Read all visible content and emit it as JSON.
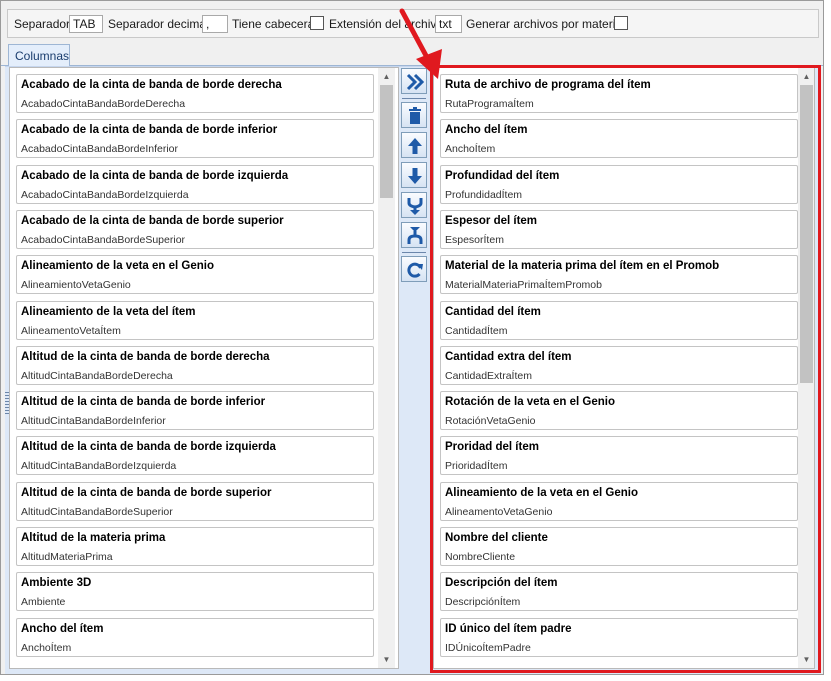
{
  "toolbar": {
    "separator_label": "Separador",
    "separator_value": "TAB",
    "decimal_label": "Separador decimal",
    "decimal_value": ",",
    "header_label": "Tiene cabecera",
    "extension_label": "Extensión del archivo",
    "extension_value": "txt",
    "per_material_label": "Generar archivos por material"
  },
  "tab": {
    "label": "Columnas"
  },
  "available": [
    {
      "title": "Acabado de la cinta de banda de borde derecha",
      "key": "AcabadoCintaBandaBordeDerecha"
    },
    {
      "title": "Acabado de la cinta de banda de borde inferior",
      "key": "AcabadoCintaBandaBordeInferior"
    },
    {
      "title": "Acabado de la cinta de banda de borde izquierda",
      "key": "AcabadoCintaBandaBordeIzquierda"
    },
    {
      "title": "Acabado de la cinta de banda de borde superior",
      "key": "AcabadoCintaBandaBordeSuperior"
    },
    {
      "title": "Alineamiento de la veta en el Genio",
      "key": "AlineamientoVetaGenio"
    },
    {
      "title": "Alineamiento de la veta del ítem",
      "key": "AlineamentoVetaÍtem"
    },
    {
      "title": "Altitud de la cinta de banda de borde derecha",
      "key": "AltitudCintaBandaBordeDerecha"
    },
    {
      "title": "Altitud de la cinta de banda de borde inferior",
      "key": "AltitudCintaBandaBordeInferior"
    },
    {
      "title": "Altitud de la cinta de banda de borde izquierda",
      "key": "AltitudCintaBandaBordeIzquierda"
    },
    {
      "title": "Altitud de la cinta de banda de borde superior",
      "key": "AltitudCintaBandaBordeSuperior"
    },
    {
      "title": "Altitud de la materia prima",
      "key": "AltitudMateriaPrima"
    },
    {
      "title": "Ambiente 3D",
      "key": "Ambiente"
    },
    {
      "title": "Ancho del ítem",
      "key": "AnchoÍtem"
    }
  ],
  "selected": [
    {
      "title": "Ruta de archivo de programa del ítem",
      "key": "RutaProgramaÍtem"
    },
    {
      "title": "Ancho del ítem",
      "key": "AnchoÍtem"
    },
    {
      "title": "Profundidad del ítem",
      "key": "ProfundidadÍtem"
    },
    {
      "title": "Espesor del ítem",
      "key": "EspesorÍtem"
    },
    {
      "title": "Material de la materia prima del ítem en el Promob",
      "key": "MaterialMateriaPrimaÍtemPromob"
    },
    {
      "title": "Cantidad del ítem",
      "key": "CantidadÍtem"
    },
    {
      "title": "Cantidad extra del ítem",
      "key": "CantidadExtraÍtem"
    },
    {
      "title": "Rotación de la veta en el Genio",
      "key": "RotaciónVetaGenio"
    },
    {
      "title": "Proridad del ítem",
      "key": "PrioridadÍtem"
    },
    {
      "title": "Alineamiento de la veta en el Genio",
      "key": "AlineamentoVetaGenio"
    },
    {
      "title": "Nombre del cliente",
      "key": "NombreCliente"
    },
    {
      "title": "Descripción del ítem",
      "key": "DescripciónÍtem"
    },
    {
      "title": "ID único del ítem padre",
      "key": "IDÚnicoÍtemPadre"
    }
  ],
  "scroll": {
    "available_position": 0.0,
    "selected_position": 0.0
  },
  "colors": {
    "highlight_frame": "#e0191f",
    "accent": "#1e5aa8"
  }
}
